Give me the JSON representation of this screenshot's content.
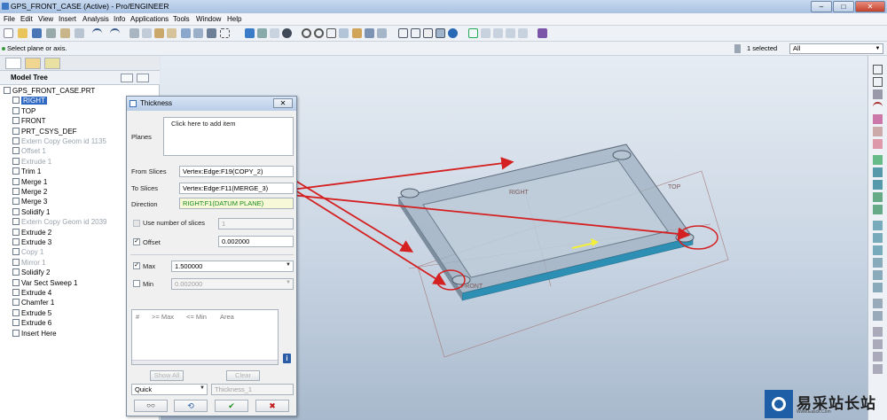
{
  "window": {
    "title": "GPS_FRONT_CASE (Active) - Pro/ENGINEER",
    "min_glyph": "–",
    "max_glyph": "□",
    "close_glyph": "✕"
  },
  "menubar": [
    "File",
    "Edit",
    "View",
    "Insert",
    "Analysis",
    "Info",
    "Applications",
    "Tools",
    "Window",
    "Help"
  ],
  "status": {
    "message": "Select plane or axis.",
    "selected": "1 selected",
    "filter": "All"
  },
  "model_tree": {
    "header": "Model Tree",
    "items": [
      {
        "label": "GPS_FRONT_CASE.PRT",
        "state": "normal"
      },
      {
        "label": "RIGHT",
        "state": "selected"
      },
      {
        "label": "TOP",
        "state": "normal"
      },
      {
        "label": "FRONT",
        "state": "normal"
      },
      {
        "label": "PRT_CSYS_DEF",
        "state": "normal"
      },
      {
        "label": "Extern Copy Geom id 1135",
        "state": "dim"
      },
      {
        "label": "Offset 1",
        "state": "dim"
      },
      {
        "label": "Extrude 1",
        "state": "dim"
      },
      {
        "label": "Trim 1",
        "state": "normal"
      },
      {
        "label": "Merge 1",
        "state": "normal"
      },
      {
        "label": "Merge 2",
        "state": "normal"
      },
      {
        "label": "Merge 3",
        "state": "normal"
      },
      {
        "label": "Solidify 1",
        "state": "normal"
      },
      {
        "label": "Extern Copy Geom id 2039",
        "state": "dim"
      },
      {
        "label": "Extrude 2",
        "state": "normal"
      },
      {
        "label": "Extrude 3",
        "state": "normal"
      },
      {
        "label": "Copy 1",
        "state": "dim"
      },
      {
        "label": "Mirror 1",
        "state": "dim"
      },
      {
        "label": "Solidify 2",
        "state": "normal"
      },
      {
        "label": "Var Sect Sweep 1",
        "state": "normal"
      },
      {
        "label": "Extrude 4",
        "state": "normal"
      },
      {
        "label": "Chamfer 1",
        "state": "normal"
      },
      {
        "label": "Extrude 5",
        "state": "normal"
      },
      {
        "label": "Extrude 6",
        "state": "normal"
      },
      {
        "label": "Insert Here",
        "state": "normal"
      }
    ]
  },
  "dialog": {
    "title": "Thickness",
    "close_glyph": "✕",
    "planes_label": "Planes",
    "planes_placeholder": "Click here to add item",
    "from_slices_label": "From Slices",
    "from_slices_value": "Vertex:Edge:F19(COPY_2)",
    "to_slices_label": "To Slices",
    "to_slices_value": "Vertex:Edge:F11(MERGE_3)",
    "direction_label": "Direction",
    "direction_value": "RIGHT:F1(DATUM PLANE)",
    "use_number_label": "Use number of slices",
    "use_number_value": "1",
    "offset_label": "Offset",
    "offset_value": "0.002000",
    "max_label": "Max",
    "max_value": "1.500000",
    "min_label": "Min",
    "min_value": "0.002000",
    "columns": [
      "#",
      ">= Max",
      "<= Min",
      "Area"
    ],
    "info_glyph": "i",
    "show_all": "Show All",
    "clear": "Clear",
    "mode": "Quick",
    "name_value": "Thickness_1",
    "btn_preview": "○○",
    "btn_repaint": "⟲",
    "btn_ok": "✔",
    "btn_cancel": "✖"
  },
  "viewport": {
    "datum_right": "RIGHT",
    "datum_top": "TOP",
    "datum_front": "FRONT"
  },
  "watermark": {
    "text": "易采站长站",
    "url": "Www.Easck.Com"
  },
  "colors": {
    "annotation": "#d42020",
    "direction_text": "#1a8a1a",
    "selection": "#2f69c4",
    "brand": "#1d5ea6"
  }
}
